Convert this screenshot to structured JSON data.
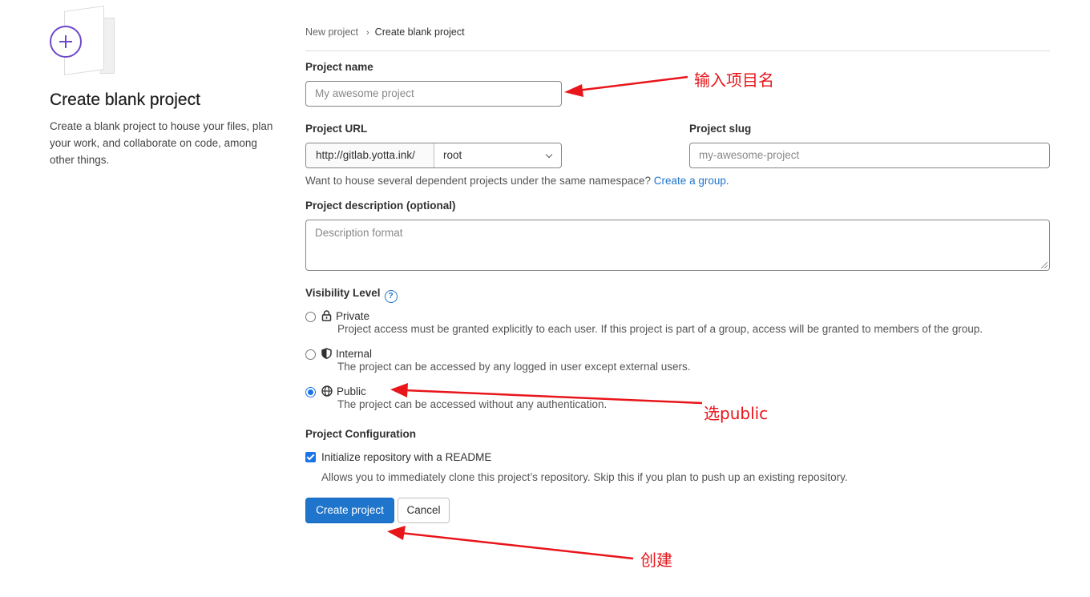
{
  "sidebar": {
    "title": "Create blank project",
    "description": "Create a blank project to house your files, plan your work, and collaborate on code, among other things."
  },
  "breadcrumb": {
    "items": [
      "New project",
      "Create blank project"
    ]
  },
  "form": {
    "project_name": {
      "label": "Project name",
      "placeholder": "My awesome project"
    },
    "project_url": {
      "label": "Project URL",
      "prefix": "http://gitlab.yotta.ink/",
      "namespace": "root"
    },
    "project_slug": {
      "label": "Project slug",
      "placeholder": "my-awesome-project"
    },
    "namespace_hint": {
      "text": "Want to house several dependent projects under the same namespace?",
      "link": "Create a group",
      "suffix": "."
    },
    "description": {
      "label": "Project description (optional)",
      "placeholder": "Description format"
    },
    "visibility": {
      "label": "Visibility Level",
      "help_glyph": "?",
      "options": [
        {
          "name": "Private",
          "icon": "lock-icon",
          "description": "Project access must be granted explicitly to each user. If this project is part of a group, access will be granted to members of the group.",
          "selected": false
        },
        {
          "name": "Internal",
          "icon": "shield-icon",
          "description": "The project can be accessed by any logged in user except external users.",
          "selected": false
        },
        {
          "name": "Public",
          "icon": "globe-icon",
          "description": "The project can be accessed without any authentication.",
          "selected": true
        }
      ]
    },
    "configuration": {
      "label": "Project Configuration",
      "readme": {
        "label": "Initialize repository with a README",
        "checked": true,
        "help": "Allows you to immediately clone this project’s repository. Skip this if you plan to push up an existing repository."
      }
    },
    "buttons": {
      "create": "Create project",
      "cancel": "Cancel"
    }
  },
  "annotations": {
    "name": "输入项目名",
    "public": "选public",
    "create": "创建",
    "color": "#e8151b"
  },
  "colors": {
    "primary": "#1f75cb",
    "accent": "#6e49cb"
  }
}
